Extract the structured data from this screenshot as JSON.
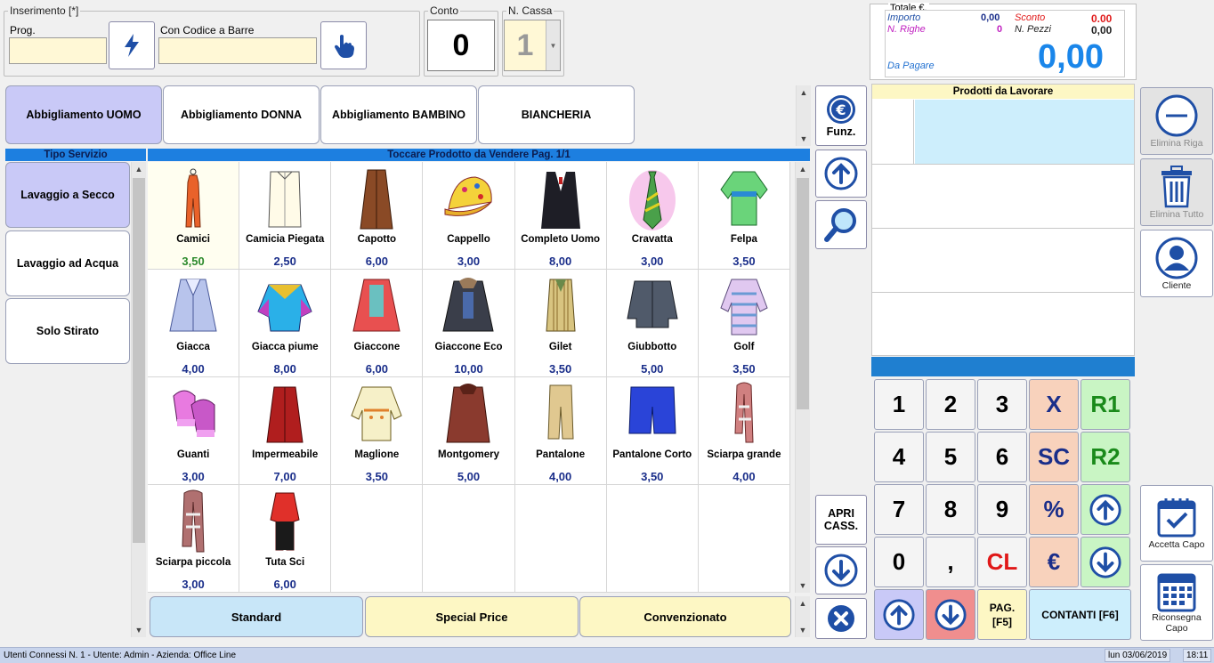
{
  "insert": {
    "legend": "Inserimento [*]",
    "prog_label": "Prog.",
    "prog_value": "",
    "barcode_label": "Con Codice a Barre",
    "barcode_value": ""
  },
  "conto": {
    "label": "Conto",
    "value": "0"
  },
  "cassa": {
    "label": "N. Cassa",
    "value": "1"
  },
  "totals": {
    "legend": "Totale €.",
    "importo_label": "Importo",
    "importo": "0,00",
    "sconto_label": "Sconto",
    "sconto": "0.00",
    "righe_label": "N. Righe",
    "righe": "0",
    "pezzi_label": "N. Pezzi",
    "pezzi": "0,00",
    "pagare_label": "Da Pagare",
    "pagare": "0,00"
  },
  "categories": [
    {
      "label": "Abbigliamento UOMO",
      "selected": true
    },
    {
      "label": "Abbigliamento DONNA"
    },
    {
      "label": "Abbigliamento BAMBINO"
    },
    {
      "label": "BIANCHERIA"
    }
  ],
  "service": {
    "header": "Tipo Servizio",
    "items": [
      {
        "label": "Lavaggio a Secco",
        "selected": true
      },
      {
        "label": "Lavaggio ad Acqua"
      },
      {
        "label": "Solo Stirato"
      }
    ]
  },
  "products_header": "Toccare Prodotto da Vendere Pag. 1/1",
  "products": [
    {
      "name": "Camici",
      "price": "3,50",
      "icon": "camici-icon"
    },
    {
      "name": "Camicia Piegata",
      "price": "2,50",
      "icon": "shirt-icon"
    },
    {
      "name": "Capotto",
      "price": "6,00",
      "icon": "coat-icon"
    },
    {
      "name": "Cappello",
      "price": "3,00",
      "icon": "cap-icon"
    },
    {
      "name": "Completo Uomo",
      "price": "8,00",
      "icon": "suit-icon"
    },
    {
      "name": "Cravatta",
      "price": "3,00",
      "icon": "tie-icon"
    },
    {
      "name": "Felpa",
      "price": "3,50",
      "icon": "sweatshirt-icon"
    },
    {
      "name": "Giacca",
      "price": "4,00",
      "icon": "jacket-icon"
    },
    {
      "name": "Giacca piume",
      "price": "8,00",
      "icon": "down-jacket-icon"
    },
    {
      "name": "Giaccone",
      "price": "6,00",
      "icon": "parka-icon"
    },
    {
      "name": "Giaccone Eco",
      "price": "10,00",
      "icon": "eco-parka-icon"
    },
    {
      "name": "Gilet",
      "price": "3,50",
      "icon": "vest-icon"
    },
    {
      "name": "Giubbotto",
      "price": "5,00",
      "icon": "bomber-icon"
    },
    {
      "name": "Golf",
      "price": "3,50",
      "icon": "pullover-icon"
    },
    {
      "name": "Guanti",
      "price": "3,00",
      "icon": "gloves-icon"
    },
    {
      "name": "Impermeabile",
      "price": "7,00",
      "icon": "raincoat-icon"
    },
    {
      "name": "Maglione",
      "price": "3,50",
      "icon": "sweater-icon"
    },
    {
      "name": "Montgomery",
      "price": "5,00",
      "icon": "montgomery-icon"
    },
    {
      "name": "Pantalone",
      "price": "4,00",
      "icon": "trousers-icon"
    },
    {
      "name": "Pantalone Corto",
      "price": "3,50",
      "icon": "shorts-icon"
    },
    {
      "name": "Sciarpa grande",
      "price": "4,00",
      "icon": "scarf-icon"
    },
    {
      "name": "Sciarpa piccola",
      "price": "3,00",
      "icon": "small-scarf-icon"
    },
    {
      "name": "Tuta Sci",
      "price": "6,00",
      "icon": "ski-suit-icon"
    }
  ],
  "price_lists": [
    "Standard",
    "Special Price",
    "Convenzionato"
  ],
  "mid": {
    "funz": "Funz.",
    "apri1": "APRI",
    "apri2": "CASS."
  },
  "work": {
    "header": "Prodotti da Lavorare"
  },
  "keypad": {
    "k1": "1",
    "k2": "2",
    "k3": "3",
    "kx": "X",
    "r1": "R1",
    "k4": "4",
    "k5": "5",
    "k6": "6",
    "sc": "SC",
    "r2": "R2",
    "k7": "7",
    "k8": "8",
    "k9": "9",
    "pct": "%",
    "k0": "0",
    "comma": ",",
    "cl": "CL",
    "eur": "€",
    "pag1": "PAG.",
    "pag2": "[F5]",
    "contanti": "CONTANTI [F6]"
  },
  "right": {
    "elimina_riga": "Elimina Riga",
    "elimina_tutto": "Elimina Tutto",
    "cliente": "Cliente",
    "accetta": "Accetta Capo",
    "riconsegna": "Riconsegna Capo"
  },
  "status": {
    "left": "Utenti Connessi N. 1 - Utente: Admin - Azienda: Office Line",
    "date": "lun 03/06/2019",
    "time": "18:11"
  }
}
